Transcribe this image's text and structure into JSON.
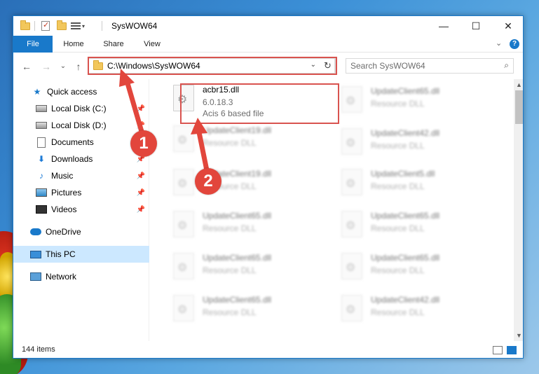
{
  "window": {
    "title": "SysWOW64",
    "minimize": "—",
    "maximize": "☐",
    "close": "✕"
  },
  "ribbon": {
    "tabs": [
      {
        "label": "File"
      },
      {
        "label": "Home"
      },
      {
        "label": "Share"
      },
      {
        "label": "View"
      }
    ],
    "collapse": "⌄",
    "help": "?"
  },
  "navigation": {
    "back": "←",
    "forward": "→",
    "recent": "⌄",
    "up": "↑",
    "address": "C:\\Windows\\SysWOW64",
    "address_dropdown": "⌄",
    "refresh": "↻",
    "search_placeholder": "Search SysWOW64",
    "search_icon": "⌕"
  },
  "sidebar": {
    "items": [
      {
        "label": "Quick access",
        "icon": "star-icon"
      },
      {
        "label": "Local Disk (C:)",
        "icon": "disk-icon",
        "pinned": true
      },
      {
        "label": "Local Disk (D:)",
        "icon": "disk-icon",
        "pinned": true
      },
      {
        "label": "Documents",
        "icon": "documents-icon",
        "pinned": true
      },
      {
        "label": "Downloads",
        "icon": "downloads-icon",
        "pinned": true
      },
      {
        "label": "Music",
        "icon": "music-icon",
        "pinned": true
      },
      {
        "label": "Pictures",
        "icon": "pictures-icon",
        "pinned": true
      },
      {
        "label": "Videos",
        "icon": "videos-icon",
        "pinned": true
      },
      {
        "label": "OneDrive",
        "icon": "onedrive-icon"
      },
      {
        "label": "This PC",
        "icon": "pc-icon",
        "selected": true
      },
      {
        "label": "Network",
        "icon": "network-icon"
      }
    ]
  },
  "files": {
    "highlighted": {
      "name": "acbr15.dll",
      "version": "6.0.18.3",
      "description": "Acis 6 based file"
    },
    "blurred_left": [
      {
        "name": "UpdateClient19.dll",
        "type": "Resource DLL"
      },
      {
        "name": "UpdateClient19.dll",
        "type": "Resource DLL"
      },
      {
        "name": "UpdateClient65.dll",
        "type": "Resource DLL"
      },
      {
        "name": "UpdateClient65.dll",
        "type": "Resource DLL"
      },
      {
        "name": "UpdateClient65.dll",
        "type": "Resource DLL"
      }
    ],
    "blurred_right": [
      {
        "name": "UpdateClient65.dll",
        "type": "Resource DLL"
      },
      {
        "name": "UpdateClient42.dll",
        "type": "Resource DLL"
      },
      {
        "name": "UpdateClient5.dll",
        "type": "Resource DLL"
      },
      {
        "name": "UpdateClient65.dll",
        "type": "Resource DLL"
      },
      {
        "name": "UpdateClient65.dll",
        "type": "Resource DLL"
      },
      {
        "name": "UpdateClient42.dll",
        "type": "Resource DLL"
      }
    ]
  },
  "status": {
    "item_count": "144 items"
  },
  "callouts": {
    "one": "1",
    "two": "2"
  },
  "colors": {
    "accent": "#1979ca",
    "highlight_box": "#d9534f",
    "callout": "#e2463c",
    "selected": "#cce8ff"
  }
}
